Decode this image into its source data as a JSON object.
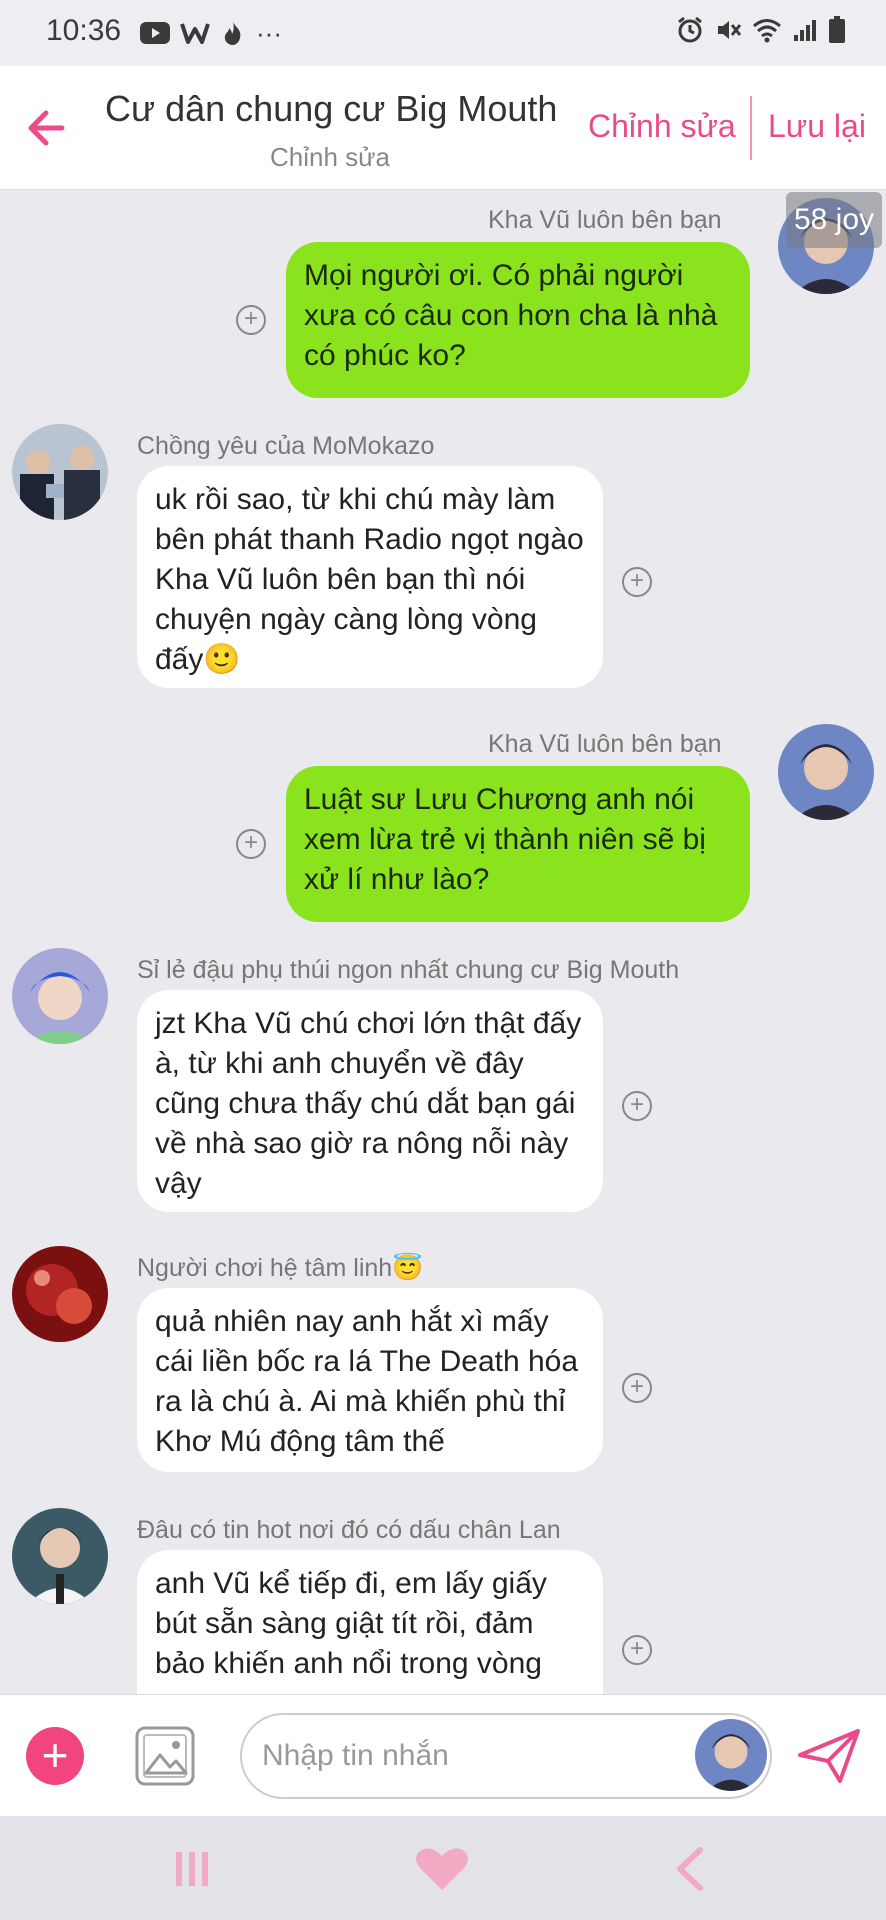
{
  "status_bar": {
    "time": "10:36",
    "more": "···"
  },
  "header": {
    "title": "Cư dân chung cư Big Mouth",
    "subtitle": "Chỉnh sửa",
    "edit_label": "Chỉnh sửa",
    "save_label": "Lưu lại"
  },
  "overlay_badge": "58 joy",
  "messages": [
    {
      "sender": "Kha Vũ luôn bên bạn",
      "text": "Mọi người ơi. Có phải người xưa có câu con hơn cha là nhà có phúc ko?",
      "own": true
    },
    {
      "sender": "Chồng yêu của MoMokazo",
      "text": "uk rồi sao, từ khi chú mày làm bên phát thanh Radio ngọt ngào Kha Vũ luôn bên bạn thì nói chuyện ngày càng lòng vòng đấy🙂",
      "own": false
    },
    {
      "sender": "Kha Vũ luôn bên bạn",
      "text": "Luật sư Lưu Chương anh nói xem lừa trẻ vị thành niên sẽ bị xử lí như lào?",
      "own": true
    },
    {
      "sender": "Sỉ lẻ đậu phụ thúi ngon nhất chung cư Big Mouth",
      "text": "jzt Kha Vũ chú chơi lớn thật đấy à,  từ khi anh chuyển về đây cũng chưa thấy chú dắt bạn gái về nhà sao giờ ra nông nỗi này vậy",
      "own": false
    },
    {
      "sender": "Người chơi hệ tâm linh😇",
      "text": "quả nhiên nay anh hắt xì mấy cái liền bốc ra lá The Death hóa ra là chú à. Ai mà khiến phù thỉ Khơ Mú động tâm thế",
      "own": false
    },
    {
      "sender": "Đâu có tin hot nơi đó có dấu chân Lan",
      "text": "anh Vũ kể tiếp đi, em lấy giấy bút sẵn sàng giật tít rồi, đảm bảo khiến anh nổi trong vòng",
      "own": false
    }
  ],
  "input": {
    "placeholder": "Nhập tin nhắn"
  },
  "colors": {
    "accent": "#ef4a8a",
    "own_bubble": "#8ae31c",
    "other_bubble": "#ffffff",
    "background": "#e9e9ee"
  }
}
